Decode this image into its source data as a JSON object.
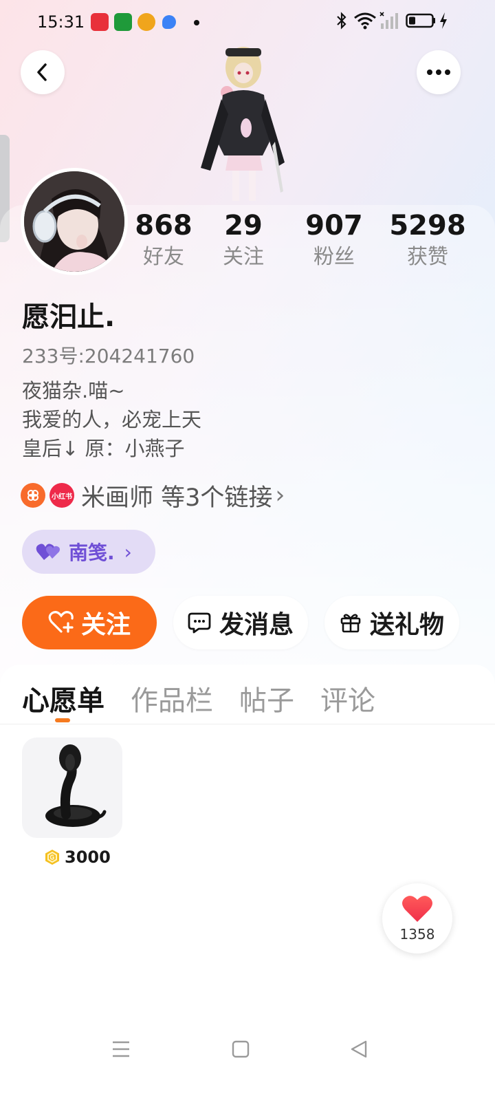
{
  "status_bar": {
    "time": "15:31",
    "notification_icons": [
      "app-red-icon",
      "app-green-icon",
      "app-orange-icon",
      "app-blue-icon"
    ],
    "system_icons": [
      "bluetooth-icon",
      "wifi-icon",
      "signal-icon",
      "battery-icon",
      "charging-icon"
    ]
  },
  "profile": {
    "stats": [
      {
        "value": "868",
        "label": "好友"
      },
      {
        "value": "29",
        "label": "关注"
      },
      {
        "value": "907",
        "label": "粉丝"
      },
      {
        "value": "5298",
        "label": "获赞"
      }
    ],
    "nickname": "愿汩止.",
    "user_id": "233号:204241760",
    "bio": [
      "夜猫杂.喵~",
      "我爱的人，必宠上天",
      "皇后↓ 原：小燕子"
    ],
    "links": {
      "badge_text": "小红书",
      "text": "米画师 等3个链接",
      "chevron": "›"
    },
    "cp_tag": {
      "label": "南笺.",
      "chevron": "›"
    }
  },
  "actions": {
    "follow": "关注",
    "message": "发消息",
    "gift": "送礼物"
  },
  "tabs": [
    {
      "label": "心愿单",
      "active": true
    },
    {
      "label": "作品栏",
      "active": false
    },
    {
      "label": "帖子",
      "active": false
    },
    {
      "label": "评论",
      "active": false
    }
  ],
  "wishlist": [
    {
      "item": "snake-item",
      "price": "3000"
    }
  ],
  "like_button": {
    "count": "1358"
  },
  "colors": {
    "accent_orange": "#fb6a18",
    "tab_indicator": "#f57a20",
    "cp_purple": "#6f4fd6",
    "cp_bg": "#e3dcf6"
  }
}
